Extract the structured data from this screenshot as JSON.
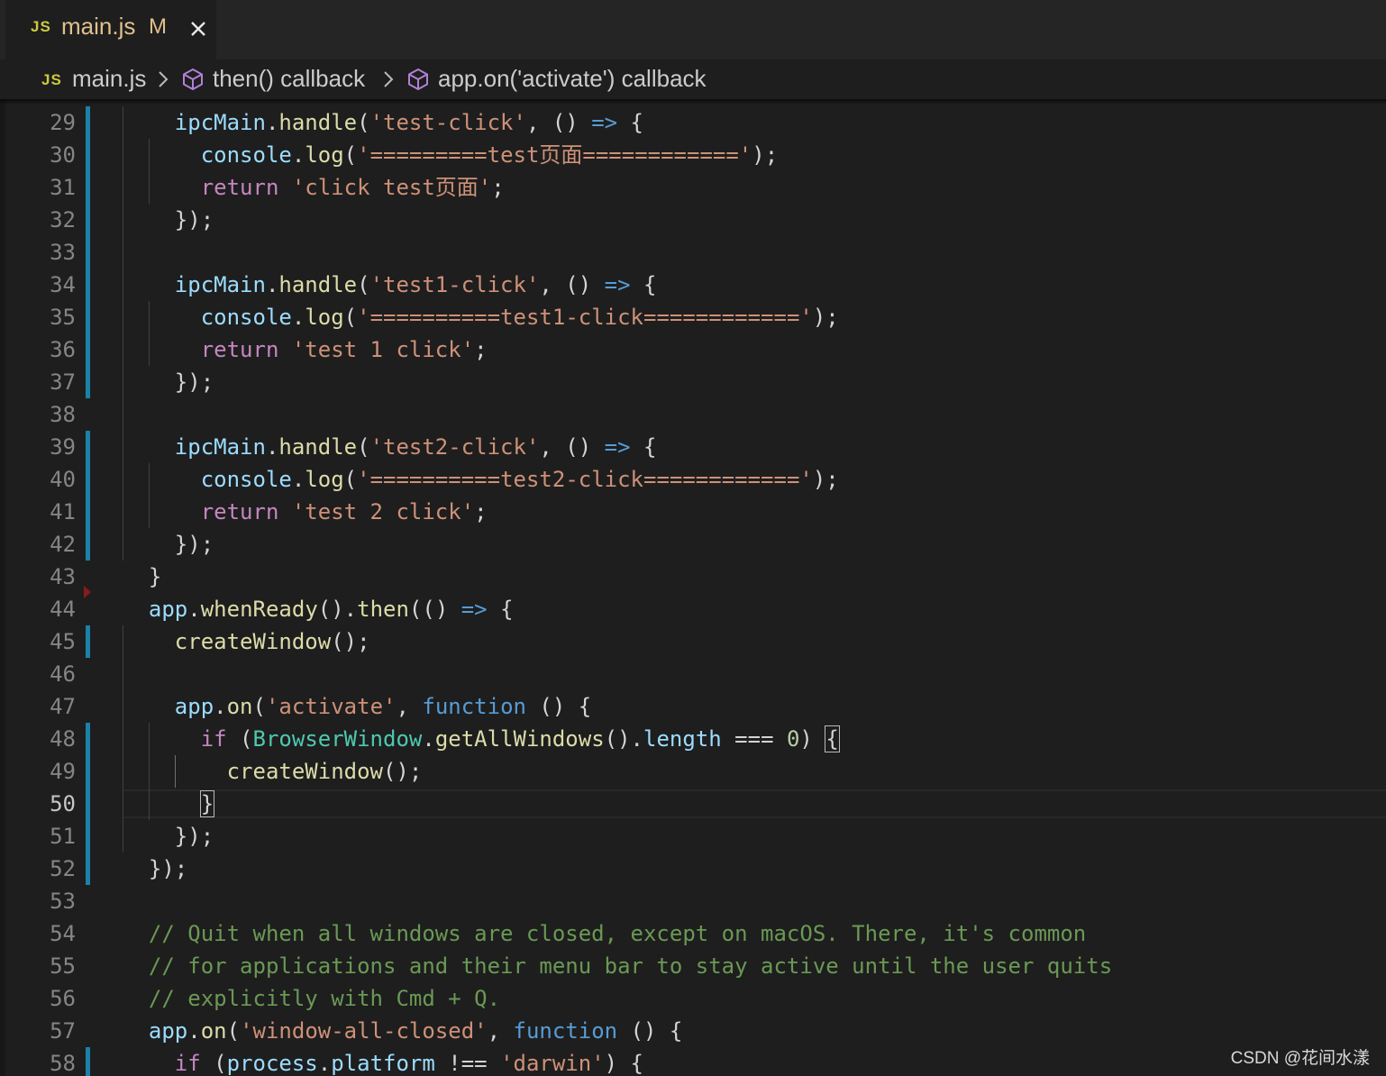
{
  "tab": {
    "icon": "javascript-file-icon",
    "badge": "JS",
    "filename": "main.js",
    "status": "M",
    "close_icon": "close-icon"
  },
  "breadcrumb": {
    "badge": "JS",
    "file": "main.js",
    "symbol1": "then() callback",
    "symbol2": "app.on('activate') callback"
  },
  "colors": {
    "background": "#1e1e1e",
    "git_modified_bar": "#1b81a8",
    "keyword": "#569cd6",
    "string": "#ce9178",
    "function": "#dcdcaa",
    "comment": "#6a9955"
  },
  "editor": {
    "active_line": "50",
    "lines": [
      {
        "n": "29",
        "seg": [
          [
            "    ",
            ""
          ],
          [
            "ipcMain",
            "var"
          ],
          [
            ".",
            ""
          ],
          [
            "handle",
            "fn"
          ],
          [
            "(",
            ""
          ],
          [
            "'test-click'",
            "str"
          ],
          [
            ", () ",
            ""
          ],
          [
            "=>",
            "kw"
          ],
          [
            " {",
            ""
          ]
        ]
      },
      {
        "n": "30",
        "seg": [
          [
            "      ",
            ""
          ],
          [
            "console",
            "var"
          ],
          [
            ".",
            ""
          ],
          [
            "log",
            "fn"
          ],
          [
            "(",
            ""
          ],
          [
            "'=========test页面============'",
            "str"
          ],
          [
            ");",
            ""
          ]
        ]
      },
      {
        "n": "31",
        "seg": [
          [
            "      ",
            ""
          ],
          [
            "return",
            "ctl"
          ],
          [
            " ",
            ""
          ],
          [
            "'click test页面'",
            "str"
          ],
          [
            ";",
            ""
          ]
        ]
      },
      {
        "n": "32",
        "seg": [
          [
            "    });",
            ""
          ]
        ]
      },
      {
        "n": "33",
        "seg": [
          [
            "",
            ""
          ]
        ]
      },
      {
        "n": "34",
        "seg": [
          [
            "    ",
            ""
          ],
          [
            "ipcMain",
            "var"
          ],
          [
            ".",
            ""
          ],
          [
            "handle",
            "fn"
          ],
          [
            "(",
            ""
          ],
          [
            "'test1-click'",
            "str"
          ],
          [
            ", () ",
            ""
          ],
          [
            "=>",
            "kw"
          ],
          [
            " {",
            ""
          ]
        ]
      },
      {
        "n": "35",
        "seg": [
          [
            "      ",
            ""
          ],
          [
            "console",
            "var"
          ],
          [
            ".",
            ""
          ],
          [
            "log",
            "fn"
          ],
          [
            "(",
            ""
          ],
          [
            "'==========test1-click============'",
            "str"
          ],
          [
            ");",
            ""
          ]
        ]
      },
      {
        "n": "36",
        "seg": [
          [
            "      ",
            ""
          ],
          [
            "return",
            "ctl"
          ],
          [
            " ",
            ""
          ],
          [
            "'test 1 click'",
            "str"
          ],
          [
            ";",
            ""
          ]
        ]
      },
      {
        "n": "37",
        "seg": [
          [
            "    });",
            ""
          ]
        ]
      },
      {
        "n": "38",
        "seg": [
          [
            "",
            ""
          ]
        ]
      },
      {
        "n": "39",
        "seg": [
          [
            "    ",
            ""
          ],
          [
            "ipcMain",
            "var"
          ],
          [
            ".",
            ""
          ],
          [
            "handle",
            "fn"
          ],
          [
            "(",
            ""
          ],
          [
            "'test2-click'",
            "str"
          ],
          [
            ", () ",
            ""
          ],
          [
            "=>",
            "kw"
          ],
          [
            " {",
            ""
          ]
        ]
      },
      {
        "n": "40",
        "seg": [
          [
            "      ",
            ""
          ],
          [
            "console",
            "var"
          ],
          [
            ".",
            ""
          ],
          [
            "log",
            "fn"
          ],
          [
            "(",
            ""
          ],
          [
            "'==========test2-click============'",
            "str"
          ],
          [
            ");",
            ""
          ]
        ]
      },
      {
        "n": "41",
        "seg": [
          [
            "      ",
            ""
          ],
          [
            "return",
            "ctl"
          ],
          [
            " ",
            ""
          ],
          [
            "'test 2 click'",
            "str"
          ],
          [
            ";",
            ""
          ]
        ]
      },
      {
        "n": "42",
        "seg": [
          [
            "    });",
            ""
          ]
        ]
      },
      {
        "n": "43",
        "seg": [
          [
            "  }",
            ""
          ]
        ]
      },
      {
        "n": "44",
        "seg": [
          [
            "  ",
            ""
          ],
          [
            "app",
            "var"
          ],
          [
            ".",
            ""
          ],
          [
            "whenReady",
            "fn"
          ],
          [
            "().",
            ""
          ],
          [
            "then",
            "fn"
          ],
          [
            "(() ",
            ""
          ],
          [
            "=>",
            "kw"
          ],
          [
            " {",
            ""
          ]
        ]
      },
      {
        "n": "45",
        "seg": [
          [
            "    ",
            ""
          ],
          [
            "createWindow",
            "fn"
          ],
          [
            "();",
            ""
          ]
        ]
      },
      {
        "n": "46",
        "seg": [
          [
            "",
            ""
          ]
        ]
      },
      {
        "n": "47",
        "seg": [
          [
            "    ",
            ""
          ],
          [
            "app",
            "var"
          ],
          [
            ".",
            ""
          ],
          [
            "on",
            "fn"
          ],
          [
            "(",
            ""
          ],
          [
            "'activate'",
            "str"
          ],
          [
            ", ",
            ""
          ],
          [
            "function",
            "kw"
          ],
          [
            " () {",
            ""
          ]
        ]
      },
      {
        "n": "48",
        "seg": [
          [
            "      ",
            ""
          ],
          [
            "if",
            "ctl"
          ],
          [
            " (",
            ""
          ],
          [
            "BrowserWindow",
            "cls"
          ],
          [
            ".",
            ""
          ],
          [
            "getAllWindows",
            "fn"
          ],
          [
            "().",
            ""
          ],
          [
            "length",
            "var"
          ],
          [
            " === ",
            ""
          ],
          [
            "0",
            "num"
          ],
          [
            ") ",
            ""
          ],
          [
            "{",
            "bm"
          ]
        ]
      },
      {
        "n": "49",
        "seg": [
          [
            "        ",
            ""
          ],
          [
            "createWindow",
            "fn"
          ],
          [
            "();",
            ""
          ]
        ]
      },
      {
        "n": "50",
        "seg": [
          [
            "      ",
            ""
          ],
          [
            "}",
            "bm"
          ]
        ]
      },
      {
        "n": "51",
        "seg": [
          [
            "    });",
            ""
          ]
        ]
      },
      {
        "n": "52",
        "seg": [
          [
            "  });",
            ""
          ]
        ]
      },
      {
        "n": "53",
        "seg": [
          [
            "",
            ""
          ]
        ]
      },
      {
        "n": "54",
        "seg": [
          [
            "  ",
            ""
          ],
          [
            "// Quit when all windows are closed, except on macOS. There, it's common",
            "cmt"
          ]
        ]
      },
      {
        "n": "55",
        "seg": [
          [
            "  ",
            ""
          ],
          [
            "// for applications and their menu bar to stay active until the user quits",
            "cmt"
          ]
        ]
      },
      {
        "n": "56",
        "seg": [
          [
            "  ",
            ""
          ],
          [
            "// explicitly with Cmd + Q.",
            "cmt"
          ]
        ]
      },
      {
        "n": "57",
        "seg": [
          [
            "  ",
            ""
          ],
          [
            "app",
            "var"
          ],
          [
            ".",
            ""
          ],
          [
            "on",
            "fn"
          ],
          [
            "(",
            ""
          ],
          [
            "'window-all-closed'",
            "str"
          ],
          [
            ", ",
            ""
          ],
          [
            "function",
            "kw"
          ],
          [
            " () {",
            ""
          ]
        ]
      },
      {
        "n": "58",
        "seg": [
          [
            "    ",
            ""
          ],
          [
            "if",
            "ctl"
          ],
          [
            " (",
            ""
          ],
          [
            "process",
            "var"
          ],
          [
            ".",
            ""
          ],
          [
            "platform",
            "var"
          ],
          [
            " !== ",
            ""
          ],
          [
            "'darwin'",
            "str"
          ],
          [
            ") {",
            ""
          ]
        ]
      }
    ]
  },
  "watermark": "CSDN @花间水漾"
}
